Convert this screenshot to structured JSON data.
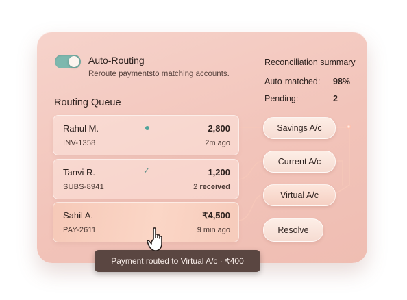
{
  "header": {
    "title": "Auto-Routing",
    "subtitle": "Reroute paymentsto matching accounts.",
    "toggle_on": true,
    "accent_color": "#7db8ae"
  },
  "queue": {
    "title": "Routing Queue",
    "items": [
      {
        "name": "Rahul M.",
        "ref": "INV-1358",
        "amount": "2,800",
        "meta": "2m ago",
        "status_icon": "dot-icon"
      },
      {
        "name": "Tanvi R.",
        "ref": "SUBS-8941",
        "amount": "1,200",
        "meta_count": "2",
        "meta_suffix": " received",
        "status_icon": "check-icon",
        "check_glyph": "✓"
      },
      {
        "name": "Sahil A.",
        "ref": "PAY-2611",
        "amount": "₹4,500",
        "meta": "9 min  ago",
        "active": true
      }
    ]
  },
  "summary": {
    "title": "Reconciliation summary",
    "auto_label": "Auto-matched:",
    "auto_value": "98%",
    "pending_label": "Pending:",
    "pending_value": "2"
  },
  "accounts": {
    "savings": "Savings A/c",
    "current": "Current A/c",
    "virtual": "Virtual A/c",
    "resolve": "Resolve"
  },
  "tooltip": {
    "text": "Payment routed to Virtual A/c · ₹400"
  },
  "cursor": {
    "icon": "hand-pointer-icon"
  }
}
